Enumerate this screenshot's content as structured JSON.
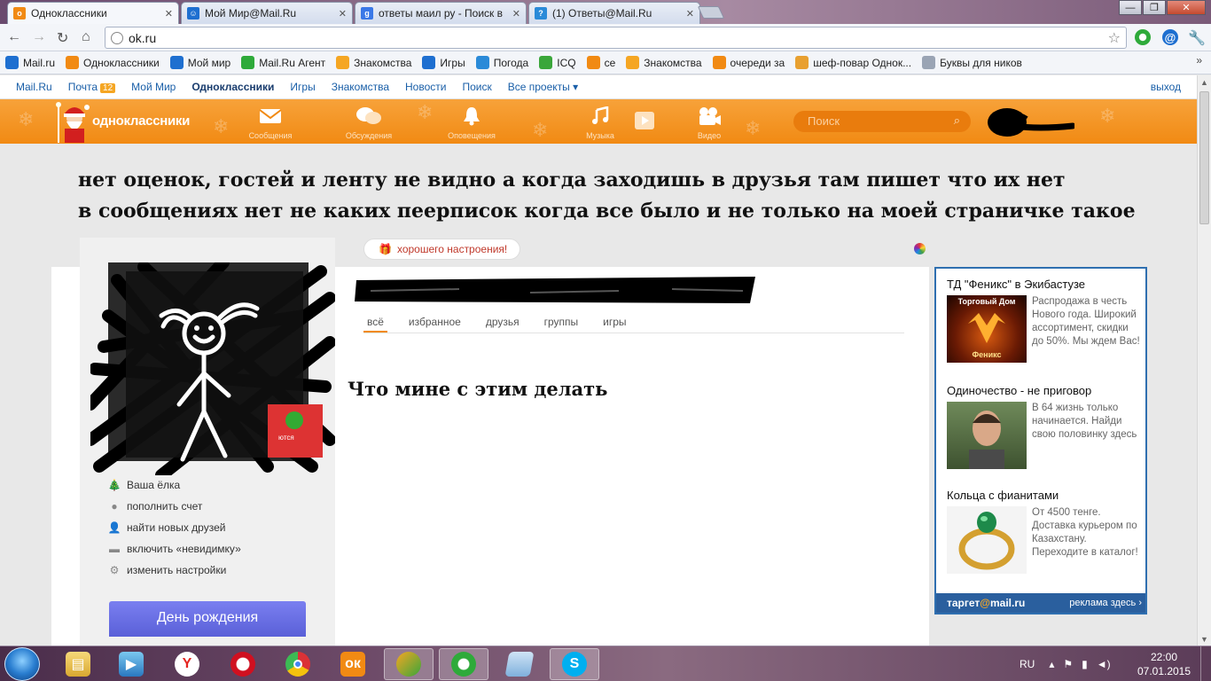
{
  "browser": {
    "tabs": [
      {
        "title": "Одноклассники",
        "icon": "ok-icon",
        "color": "#f18a13",
        "active": true
      },
      {
        "title": "Мой Мир@Mail.Ru",
        "icon": "mymir-icon",
        "color": "#1e6fd0",
        "active": false
      },
      {
        "title": "ответы маил ру - Поиск в",
        "icon": "google-icon",
        "color": "#3a78e7",
        "active": false
      },
      {
        "title": "(1) Ответы@Mail.Ru",
        "icon": "answers-icon",
        "color": "#2a8ad8",
        "active": false
      }
    ],
    "url": "ok.ru"
  },
  "bookmarks": [
    {
      "label": "Mail.ru",
      "icon": "mailru-icon",
      "color": "#1e6fd0"
    },
    {
      "label": "Одноклассники",
      "icon": "ok-icon",
      "color": "#f18a13"
    },
    {
      "label": "Мой мир",
      "icon": "mymir-icon",
      "color": "#1e6fd0"
    },
    {
      "label": "Mail.Ru Агент",
      "icon": "agent-icon",
      "color": "#2eaa3a"
    },
    {
      "label": "Знакомства",
      "icon": "heart-icon",
      "color": "#f5a623"
    },
    {
      "label": "Игры",
      "icon": "games-icon",
      "color": "#1e6fd0"
    },
    {
      "label": "Погода",
      "icon": "weather-icon",
      "color": "#2a8ad8"
    },
    {
      "label": "ICQ",
      "icon": "icq-icon",
      "color": "#3aa63a"
    },
    {
      "label": "се",
      "icon": "ok-icon",
      "color": "#f18a13"
    },
    {
      "label": "Знакомства",
      "icon": "heart-icon",
      "color": "#f5a623"
    },
    {
      "label": "очереди за",
      "icon": "ok-icon",
      "color": "#f18a13"
    },
    {
      "label": "шеф-повар Однок...",
      "icon": "mail-icon",
      "color": "#e8a030"
    },
    {
      "label": "Буквы для ников",
      "icon": "page-icon",
      "color": "#9aa4b4"
    }
  ],
  "portal": {
    "links": [
      "Mail.Ru",
      "Почта",
      "Мой Мир",
      "Одноклассники",
      "Игры",
      "Знакомства",
      "Новости",
      "Поиск",
      "Все проекты ▾"
    ],
    "mail_count": "12",
    "exit": "выход"
  },
  "okbar": {
    "logo": "одноклассники",
    "items": [
      {
        "label": "Сообщения",
        "icon": "envelope-icon"
      },
      {
        "label": "Обсуждения",
        "icon": "chat-bubbles-icon"
      },
      {
        "label": "Оповещения",
        "icon": "bell-icon"
      },
      {
        "label": "Музыка",
        "icon": "music-note-icon"
      },
      {
        "label": "Видео",
        "icon": "video-camera-icon"
      }
    ],
    "search_placeholder": "Поиск"
  },
  "caption": {
    "line1": "нет  оценок, гостей  и ленту не видно а когда заходишь в друзья там пишет что их нет",
    "line2": "в сообщениях нет не каких пеерписок когда все было и не только на моей страничке такое"
  },
  "profile": {
    "gift_text": "хорошего настроения!",
    "menu": [
      {
        "label": "Ваша ёлка",
        "icon": "tree-icon"
      },
      {
        "label": "пополнить счет",
        "icon": "coins-icon"
      },
      {
        "label": "найти новых друзей",
        "icon": "person-icon"
      },
      {
        "label": "включить «невидимку»",
        "icon": "hat-icon"
      },
      {
        "label": "изменить настройки",
        "icon": "gear-icon"
      }
    ],
    "birthday": "День рождения",
    "feed_tabs": [
      "всё",
      "избранное",
      "друзья",
      "группы",
      "игры"
    ],
    "question": "Что мине с  этим делать"
  },
  "ads": [
    {
      "title": "ТД \"Феникс\" в Экибастузе",
      "text": "Распродажа в честь Нового года. Широкий ассортимент, скидки до 50%. Мы ждем Вас!",
      "image_caption": "Торговый Дом",
      "image_caption2": "Феникс"
    },
    {
      "title": "Одиночество - не приговор",
      "text": "В 64 жизнь только начинается. Найди свою половинку здесь"
    },
    {
      "title": "Кольца с фианитами",
      "text": "От 4500 тенге. Доставка курьером по Казахстану. Переходите в каталог!"
    }
  ],
  "ad_footer": {
    "brand_pre": "таргет",
    "brand_post": "mail.ru",
    "link": "реклама здесь ›"
  },
  "taskbar": {
    "lang": "RU",
    "time": "22:00",
    "date": "07.01.2015"
  }
}
